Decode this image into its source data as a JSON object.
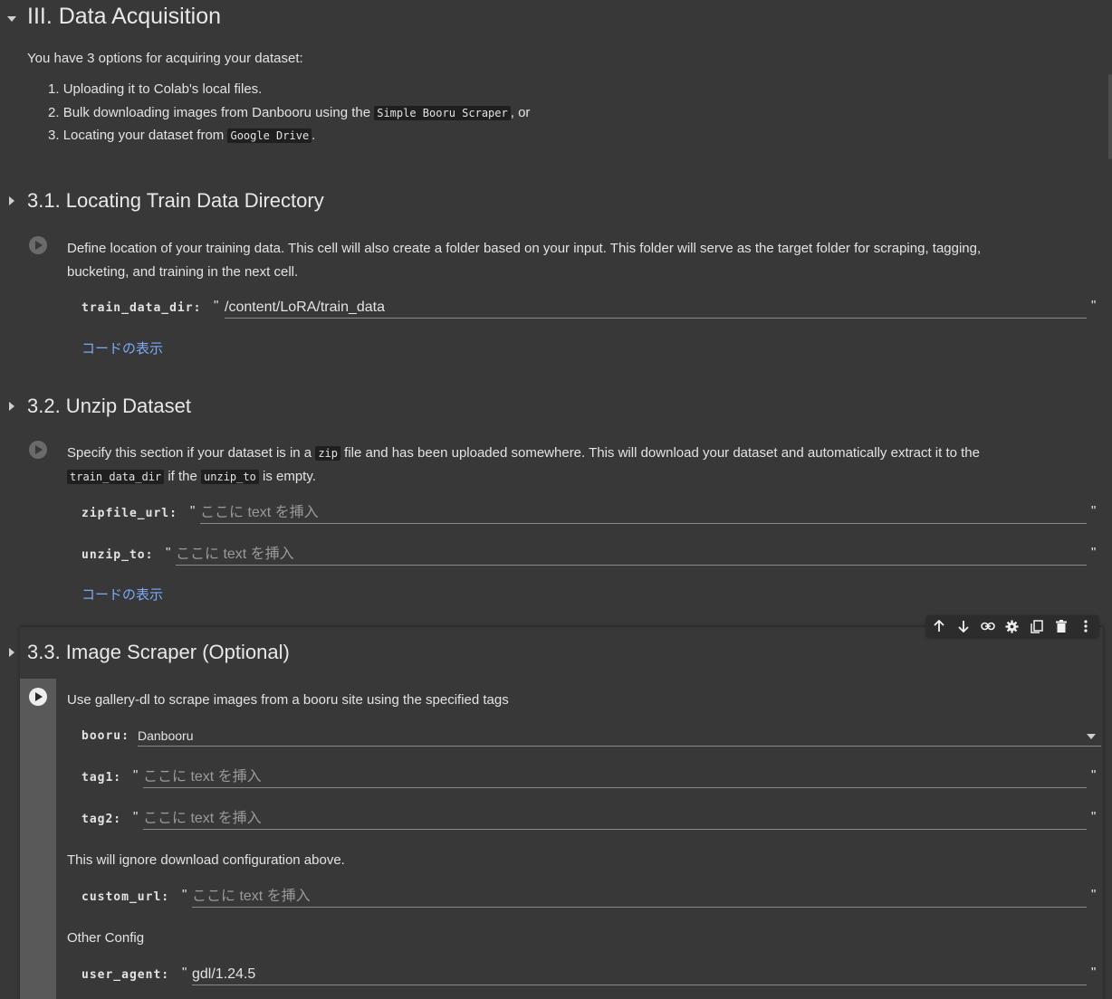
{
  "section_main": {
    "title": "III. Data Acquisition",
    "intro": "You have 3 options for acquiring your dataset:",
    "options": [
      {
        "num": "1.",
        "pre": "Uploading it to Colab's local files.",
        "code": "",
        "post": ""
      },
      {
        "num": "2.",
        "pre": "Bulk downloading images from Danbooru using the",
        "code": "Simple Booru Scraper",
        "post": ", or"
      },
      {
        "num": "3.",
        "pre": "Locating your dataset from",
        "code": "Google Drive",
        "post": "."
      }
    ]
  },
  "cell_31": {
    "title": "3.1. Locating Train Data Directory",
    "desc_line1": "Define location of your training data. This cell will also create a folder based on your input. This folder will serve as the target folder for scraping, tagging,",
    "desc_line2": "bucketing, and training in the next cell.",
    "field_label": "train_data_dir:",
    "field_value": "/content/LoRA/train_data",
    "show_code": "コードの表示"
  },
  "cell_32": {
    "title": "3.2. Unzip Dataset",
    "desc_a": "Specify this section if your dataset is in a",
    "desc_code1": "zip",
    "desc_b": "file and has been uploaded somewhere. This will download your dataset and automatically extract it to the",
    "desc_code2": "train_data_dir",
    "desc_c": "if the",
    "desc_code3": "unzip_to",
    "desc_d": "is empty.",
    "zip_label": "zipfile_url:",
    "unzip_label": "unzip_to:",
    "placeholder": "ここに text を挿入",
    "show_code": "コードの表示"
  },
  "cell_33": {
    "title": "3.3. Image Scraper (Optional)",
    "desc": "Use gallery-dl to scrape images from a booru site using the specified tags",
    "booru_label": "booru:",
    "booru_value": "Danbooru",
    "tag1_label": "tag1:",
    "tag2_label": "tag2:",
    "placeholder": "ここに text を挿入",
    "note": "This will ignore download configuration above.",
    "custom_url_label": "custom_url:",
    "other_config": "Other Config",
    "user_agent_label": "user_agent:",
    "user_agent_value": "gdl/1.24.5"
  },
  "quote_char": "\"",
  "icons": [
    "arrow-up-icon",
    "arrow-down-icon",
    "link-icon",
    "gear-icon",
    "mirror-cell-icon",
    "trash-icon",
    "more-vert-icon"
  ],
  "colors": {
    "background": "#383838",
    "active_gutter": "#595959",
    "link": "#7baaf7",
    "placeholder": "#9a9a9a"
  }
}
